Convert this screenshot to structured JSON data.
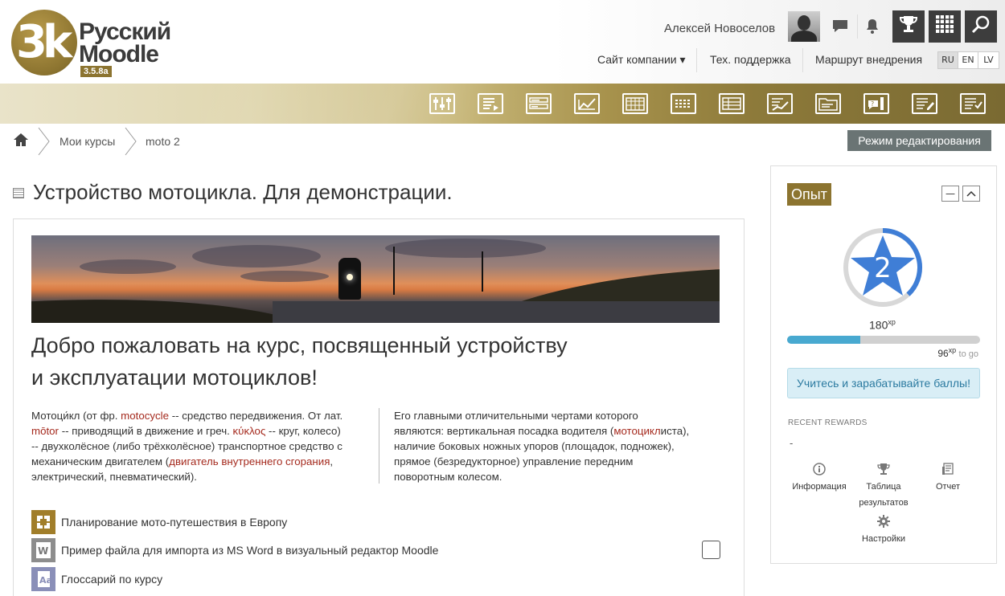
{
  "header": {
    "logo": {
      "mark": "3k",
      "line1": "Русский",
      "line2": "Moodle",
      "version": "3.5.8a"
    },
    "user_name": "Алексей Новоселов",
    "nav": [
      {
        "label": "Сайт компании ▾"
      },
      {
        "label": "Тех. поддержка"
      },
      {
        "label": "Маршрут внедрения"
      }
    ],
    "languages": [
      "RU",
      "EN",
      "LV"
    ],
    "active_language": "RU",
    "icons": [
      "message-icon",
      "bell-icon",
      "trophy-icon",
      "grid-icon",
      "search-icon"
    ]
  },
  "banner_icons": [
    "settings-icon",
    "report-icon",
    "form-icon",
    "analytics-icon",
    "calendar-icon",
    "rating-icon",
    "table-icon",
    "chart-icon",
    "folder-icon",
    "question-icon",
    "edit-icon",
    "checklist-icon"
  ],
  "breadcrumb": {
    "home_icon": "home-icon",
    "items": [
      "Мои курсы",
      "moto 2"
    ]
  },
  "edit_mode_button": "Режим редактирования",
  "course": {
    "title": "Устройство мотоцикла. Для демонстрации.",
    "welcome_line1": "Добро пожаловать на курс, посвященный устройству",
    "welcome_line2": "и эксплуатации мотоциклов!",
    "para1": {
      "t1": "Мотоци́кл (от фр. ",
      "l1": "motocycle",
      "t2": " -- средство передвижения. От лат.",
      "l2": "mōtor",
      "t3": " -- приводящий в движение и греч. ",
      "l3": "κύκλος",
      "t4": " -- круг, колесо)",
      "t5": "-- двухколёсное (либо трёхколёсное) транспортное средство с",
      "t6": "механическим двигателем (",
      "l4": "двигатель внутреннего сгорания",
      "t7": ",",
      "t8": "электрический, пневматический)."
    },
    "para2": {
      "line1": "Его главными отличительными чертами которого",
      "line2a": "являются: вертикальная посадка водителя (",
      "line2l": "мотоцикл",
      "line2b": "иста),",
      "line3": "наличие боковых ножных упоров (площадок, подножек),",
      "line4": "прямое (безредукторное) управление передним",
      "line5": "поворотным колесом."
    },
    "activities": [
      {
        "label": "Планирование мото-путешествия в Европу",
        "icon": "workshop-icon",
        "color": "#a17e2a"
      },
      {
        "label": "Пример файла для импорта из MS Word в визуальный редактор Moodle",
        "icon": "word-file-icon",
        "color": "#8d8d8d"
      },
      {
        "label": "Глоссарий по курсу",
        "icon": "glossary-icon",
        "color": "#8a8fb8"
      }
    ]
  },
  "xp_block": {
    "title": "Опыт",
    "level": "2",
    "xp": "180",
    "xp_unit": "xp",
    "progress": 0.38,
    "to_go": "96",
    "to_go_unit": "xp",
    "to_go_text": "to go",
    "info": "Учитесь и зарабатывайте баллы!",
    "recent_label": "RECENT REWARDS",
    "recent_value": "-",
    "links": [
      {
        "label1": "Информация",
        "label2": "",
        "icon": "info-icon"
      },
      {
        "label1": "Таблица",
        "label2": "результатов",
        "icon": "trophy-icon"
      },
      {
        "label1": "Отчет",
        "label2": "",
        "icon": "report-icon"
      },
      {
        "label1": "Настройки",
        "label2": "",
        "icon": "gear-icon"
      }
    ],
    "colors": {
      "accent": "#8c7430",
      "star": "#3f7ed6",
      "bar": "#48a9d0"
    }
  }
}
